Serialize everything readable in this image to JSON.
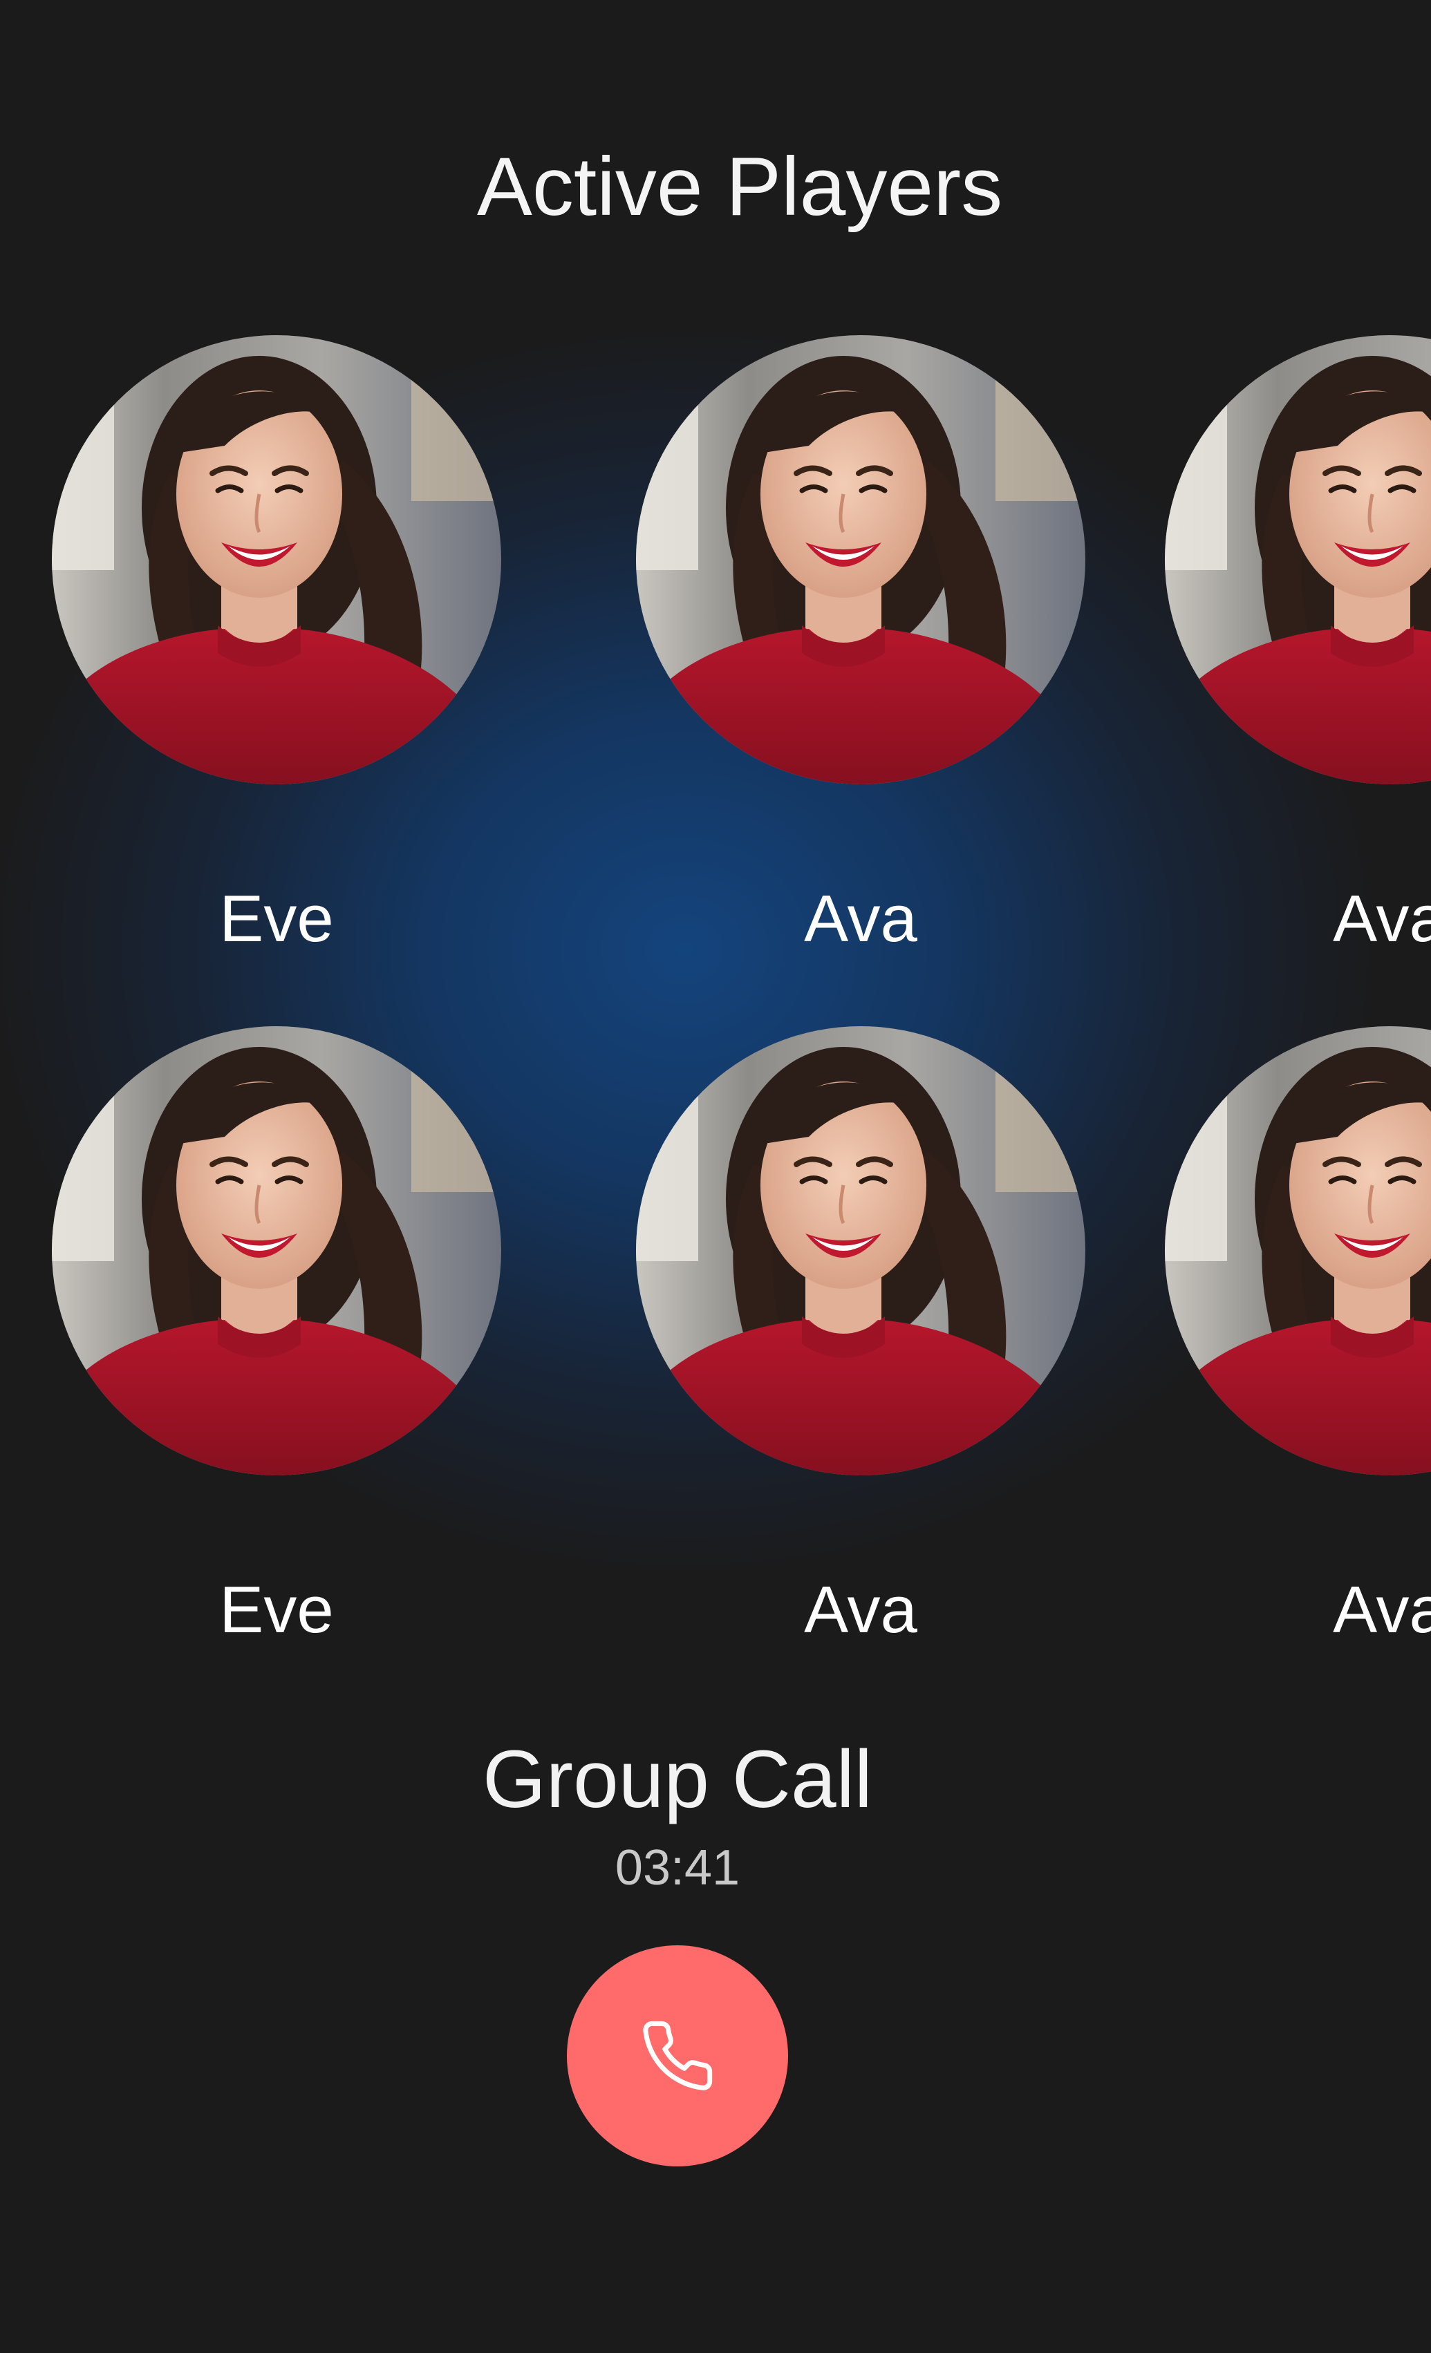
{
  "header": {
    "title": "Active Players"
  },
  "players": [
    {
      "name": "Eve"
    },
    {
      "name": "Ava"
    },
    {
      "name": "Ava"
    },
    {
      "name": "Eve"
    },
    {
      "name": "Ava"
    },
    {
      "name": "Ava"
    }
  ],
  "call": {
    "title": "Group Call",
    "duration": "03:41",
    "end_call_icon": "phone-icon"
  },
  "colors": {
    "background": "#1b1b1c",
    "glow": "#14467f",
    "end_call_button": "#ff6b6b",
    "avatar_sweater": "#a51226"
  }
}
